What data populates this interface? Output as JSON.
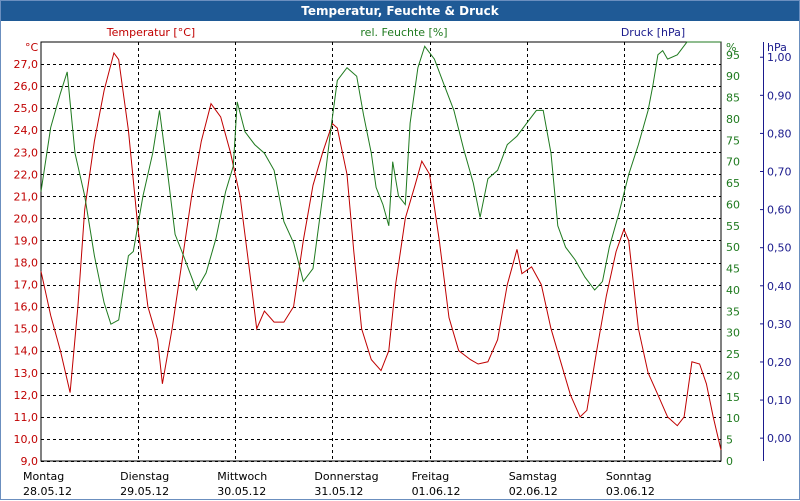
{
  "title": "Temperatur, Feuchte & Druck",
  "chart_data": {
    "type": "line",
    "title": "Temperatur, Feuchte & Druck",
    "x_categories": [
      {
        "day": "Montag",
        "date": "28.05.12"
      },
      {
        "day": "Dienstag",
        "date": "29.05.12"
      },
      {
        "day": "Mittwoch",
        "date": "30.05.12"
      },
      {
        "day": "Donnerstag",
        "date": "31.05.12"
      },
      {
        "day": "Freitag",
        "date": "01.06.12"
      },
      {
        "day": "Samstag",
        "date": "02.06.12"
      },
      {
        "day": "Sonntag",
        "date": "03.06.12"
      }
    ],
    "xlim_days": [
      0,
      7
    ],
    "grid": true,
    "axes": {
      "temperature": {
        "label": "Temperatur [°C]",
        "unit": "°C",
        "color": "#c00000",
        "ylim": [
          9.0,
          28.0
        ],
        "ticks": [
          "9,0",
          "10,0",
          "11,0",
          "12,0",
          "13,0",
          "14,0",
          "15,0",
          "16,0",
          "17,0",
          "18,0",
          "19,0",
          "20,0",
          "21,0",
          "22,0",
          "23,0",
          "24,0",
          "25,0",
          "26,0",
          "27,0"
        ],
        "tick_values": [
          9,
          10,
          11,
          12,
          13,
          14,
          15,
          16,
          17,
          18,
          19,
          20,
          21,
          22,
          23,
          24,
          25,
          26,
          27
        ]
      },
      "humidity": {
        "label": "rel. Feuchte [%]",
        "unit": "%",
        "color": "#1f7a1f",
        "ylim": [
          0,
          98
        ],
        "ticks": [
          "0",
          "5",
          "10",
          "15",
          "20",
          "25",
          "30",
          "35",
          "40",
          "45",
          "50",
          "55",
          "60",
          "65",
          "70",
          "75",
          "80",
          "85",
          "90",
          "95"
        ],
        "tick_values": [
          0,
          5,
          10,
          15,
          20,
          25,
          30,
          35,
          40,
          45,
          50,
          55,
          60,
          65,
          70,
          75,
          80,
          85,
          90,
          95
        ]
      },
      "pressure": {
        "label": "Druck [hPa]",
        "unit": "hPa",
        "color": "#1a1a8c",
        "ylim": [
          -0.06,
          1.04
        ],
        "ticks": [
          "0,00",
          "0,10",
          "0,20",
          "0,30",
          "0,40",
          "0,50",
          "0,60",
          "0,70",
          "0,80",
          "0,90",
          "1,00"
        ],
        "tick_values": [
          0,
          0.1,
          0.2,
          0.3,
          0.4,
          0.5,
          0.6,
          0.7,
          0.8,
          0.9,
          1.0
        ]
      }
    },
    "series": [
      {
        "name": "Temperatur [°C]",
        "axis": "temperature",
        "color": "#c00000",
        "points": [
          [
            0,
            17.6
          ],
          [
            0.1,
            15.6
          ],
          [
            0.2,
            14.0
          ],
          [
            0.3,
            12.1
          ],
          [
            0.38,
            16.0
          ],
          [
            0.45,
            20.4
          ],
          [
            0.55,
            23.5
          ],
          [
            0.65,
            25.8
          ],
          [
            0.75,
            27.5
          ],
          [
            0.8,
            27.2
          ],
          [
            0.9,
            24.0
          ],
          [
            1.0,
            19.5
          ],
          [
            1.1,
            16.0
          ],
          [
            1.2,
            14.5
          ],
          [
            1.25,
            12.5
          ],
          [
            1.35,
            15.0
          ],
          [
            1.45,
            18.0
          ],
          [
            1.55,
            21.0
          ],
          [
            1.65,
            23.5
          ],
          [
            1.75,
            25.2
          ],
          [
            1.85,
            24.6
          ],
          [
            1.95,
            23.0
          ],
          [
            2.05,
            21.0
          ],
          [
            2.15,
            17.5
          ],
          [
            2.22,
            15.0
          ],
          [
            2.3,
            15.8
          ],
          [
            2.4,
            15.3
          ],
          [
            2.5,
            15.3
          ],
          [
            2.6,
            16.0
          ],
          [
            2.7,
            19.0
          ],
          [
            2.8,
            21.5
          ],
          [
            2.9,
            23.0
          ],
          [
            3.0,
            24.3
          ],
          [
            3.05,
            24.1
          ],
          [
            3.15,
            22.0
          ],
          [
            3.22,
            18.5
          ],
          [
            3.3,
            15.0
          ],
          [
            3.4,
            13.6
          ],
          [
            3.5,
            13.1
          ],
          [
            3.58,
            14.0
          ],
          [
            3.65,
            17.0
          ],
          [
            3.75,
            20.0
          ],
          [
            3.85,
            21.5
          ],
          [
            3.92,
            22.6
          ],
          [
            4.0,
            22.0
          ],
          [
            4.1,
            19.0
          ],
          [
            4.2,
            15.5
          ],
          [
            4.3,
            14.0
          ],
          [
            4.42,
            13.6
          ],
          [
            4.5,
            13.4
          ],
          [
            4.6,
            13.5
          ],
          [
            4.7,
            14.5
          ],
          [
            4.8,
            17.0
          ],
          [
            4.9,
            18.6
          ],
          [
            4.95,
            17.5
          ],
          [
            5.05,
            17.8
          ],
          [
            5.15,
            17.0
          ],
          [
            5.25,
            15.0
          ],
          [
            5.35,
            13.5
          ],
          [
            5.45,
            12.0
          ],
          [
            5.55,
            11.0
          ],
          [
            5.62,
            11.3
          ],
          [
            5.72,
            14.0
          ],
          [
            5.82,
            16.5
          ],
          [
            5.92,
            18.5
          ],
          [
            6.0,
            19.5
          ],
          [
            6.05,
            19.0
          ],
          [
            6.15,
            15.0
          ],
          [
            6.25,
            13.0
          ],
          [
            6.35,
            12.0
          ],
          [
            6.45,
            11.0
          ],
          [
            6.55,
            10.6
          ],
          [
            6.62,
            11.0
          ],
          [
            6.7,
            13.5
          ],
          [
            6.78,
            13.4
          ],
          [
            6.85,
            12.5
          ],
          [
            6.92,
            11.0
          ],
          [
            7.0,
            9.5
          ]
        ]
      },
      {
        "name": "rel. Feuchte [%]",
        "axis": "humidity",
        "color": "#1f7a1f",
        "points": [
          [
            0,
            63
          ],
          [
            0.1,
            78
          ],
          [
            0.2,
            86
          ],
          [
            0.27,
            91
          ],
          [
            0.35,
            72
          ],
          [
            0.45,
            62
          ],
          [
            0.55,
            48
          ],
          [
            0.65,
            37
          ],
          [
            0.72,
            32
          ],
          [
            0.8,
            33
          ],
          [
            0.9,
            48
          ],
          [
            0.95,
            49
          ],
          [
            1.05,
            62
          ],
          [
            1.15,
            72
          ],
          [
            1.22,
            82
          ],
          [
            1.3,
            68
          ],
          [
            1.38,
            53
          ],
          [
            1.45,
            49
          ],
          [
            1.55,
            43
          ],
          [
            1.6,
            40
          ],
          [
            1.7,
            44
          ],
          [
            1.8,
            52
          ],
          [
            1.9,
            63
          ],
          [
            1.98,
            69
          ],
          [
            2.02,
            84
          ],
          [
            2.1,
            77
          ],
          [
            2.2,
            74
          ],
          [
            2.3,
            72
          ],
          [
            2.4,
            68
          ],
          [
            2.5,
            56
          ],
          [
            2.6,
            51
          ],
          [
            2.7,
            42
          ],
          [
            2.8,
            45
          ],
          [
            2.9,
            62
          ],
          [
            2.98,
            77
          ],
          [
            3.05,
            89
          ],
          [
            3.15,
            92
          ],
          [
            3.25,
            90
          ],
          [
            3.32,
            81
          ],
          [
            3.4,
            72
          ],
          [
            3.45,
            64
          ],
          [
            3.52,
            60
          ],
          [
            3.58,
            55
          ],
          [
            3.62,
            70
          ],
          [
            3.68,
            62
          ],
          [
            3.75,
            60
          ],
          [
            3.8,
            79
          ],
          [
            3.88,
            92
          ],
          [
            3.95,
            97
          ],
          [
            4.05,
            94
          ],
          [
            4.15,
            88
          ],
          [
            4.25,
            82
          ],
          [
            4.35,
            73
          ],
          [
            4.45,
            65
          ],
          [
            4.52,
            57
          ],
          [
            4.6,
            66
          ],
          [
            4.7,
            68
          ],
          [
            4.8,
            74
          ],
          [
            4.9,
            76
          ],
          [
            5.0,
            79
          ],
          [
            5.1,
            82
          ],
          [
            5.17,
            82
          ],
          [
            5.25,
            72
          ],
          [
            5.32,
            55
          ],
          [
            5.4,
            50
          ],
          [
            5.5,
            47
          ],
          [
            5.6,
            43
          ],
          [
            5.7,
            40
          ],
          [
            5.78,
            42
          ],
          [
            5.85,
            50
          ],
          [
            5.95,
            58
          ],
          [
            6.05,
            67
          ],
          [
            6.15,
            74
          ],
          [
            6.25,
            82
          ],
          [
            6.3,
            88
          ],
          [
            6.35,
            95
          ],
          [
            6.4,
            96
          ],
          [
            6.45,
            94
          ],
          [
            6.55,
            95
          ],
          [
            6.65,
            98
          ],
          [
            6.8,
            98
          ],
          [
            7.0,
            98
          ]
        ]
      }
    ]
  }
}
